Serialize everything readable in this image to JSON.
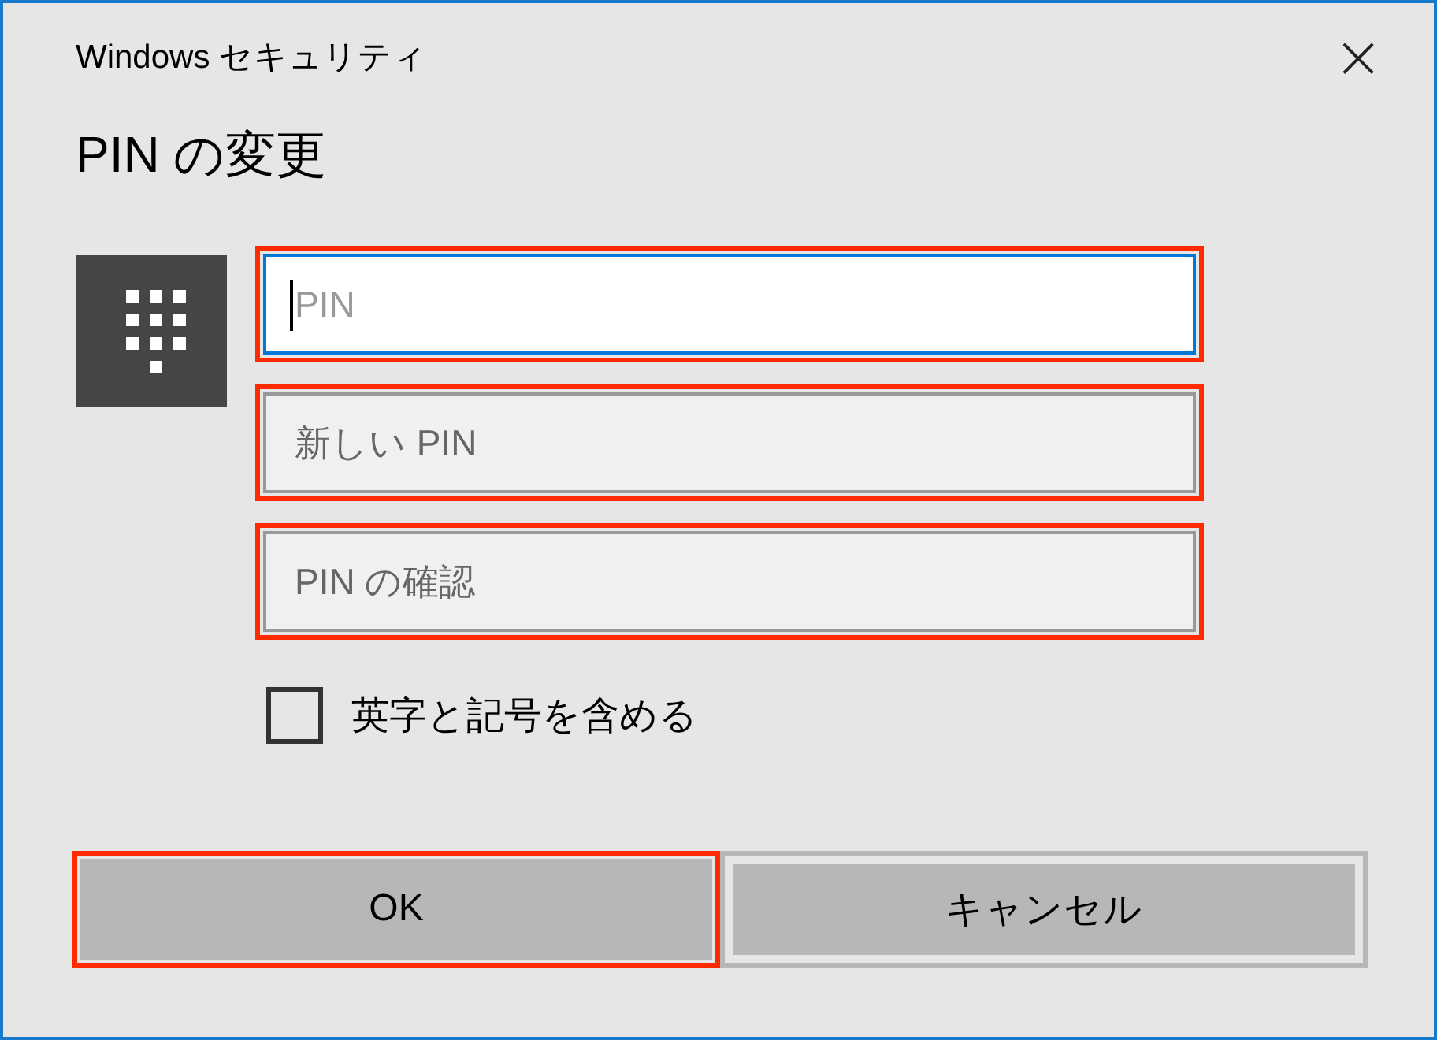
{
  "window": {
    "title": "Windows セキュリティ",
    "close": "×"
  },
  "heading": "PIN の変更",
  "fields": [
    {
      "placeholder": "PIN",
      "focused": true,
      "highlighted": true
    },
    {
      "placeholder": "新しい PIN",
      "focused": false,
      "highlighted": true
    },
    {
      "placeholder": "PIN の確認",
      "focused": false,
      "highlighted": true
    }
  ],
  "checkbox": {
    "label": "英字と記号を含める",
    "checked": false
  },
  "buttons": [
    {
      "label": "OK",
      "highlighted": true
    },
    {
      "label": "キャンセル",
      "highlighted": false
    }
  ]
}
